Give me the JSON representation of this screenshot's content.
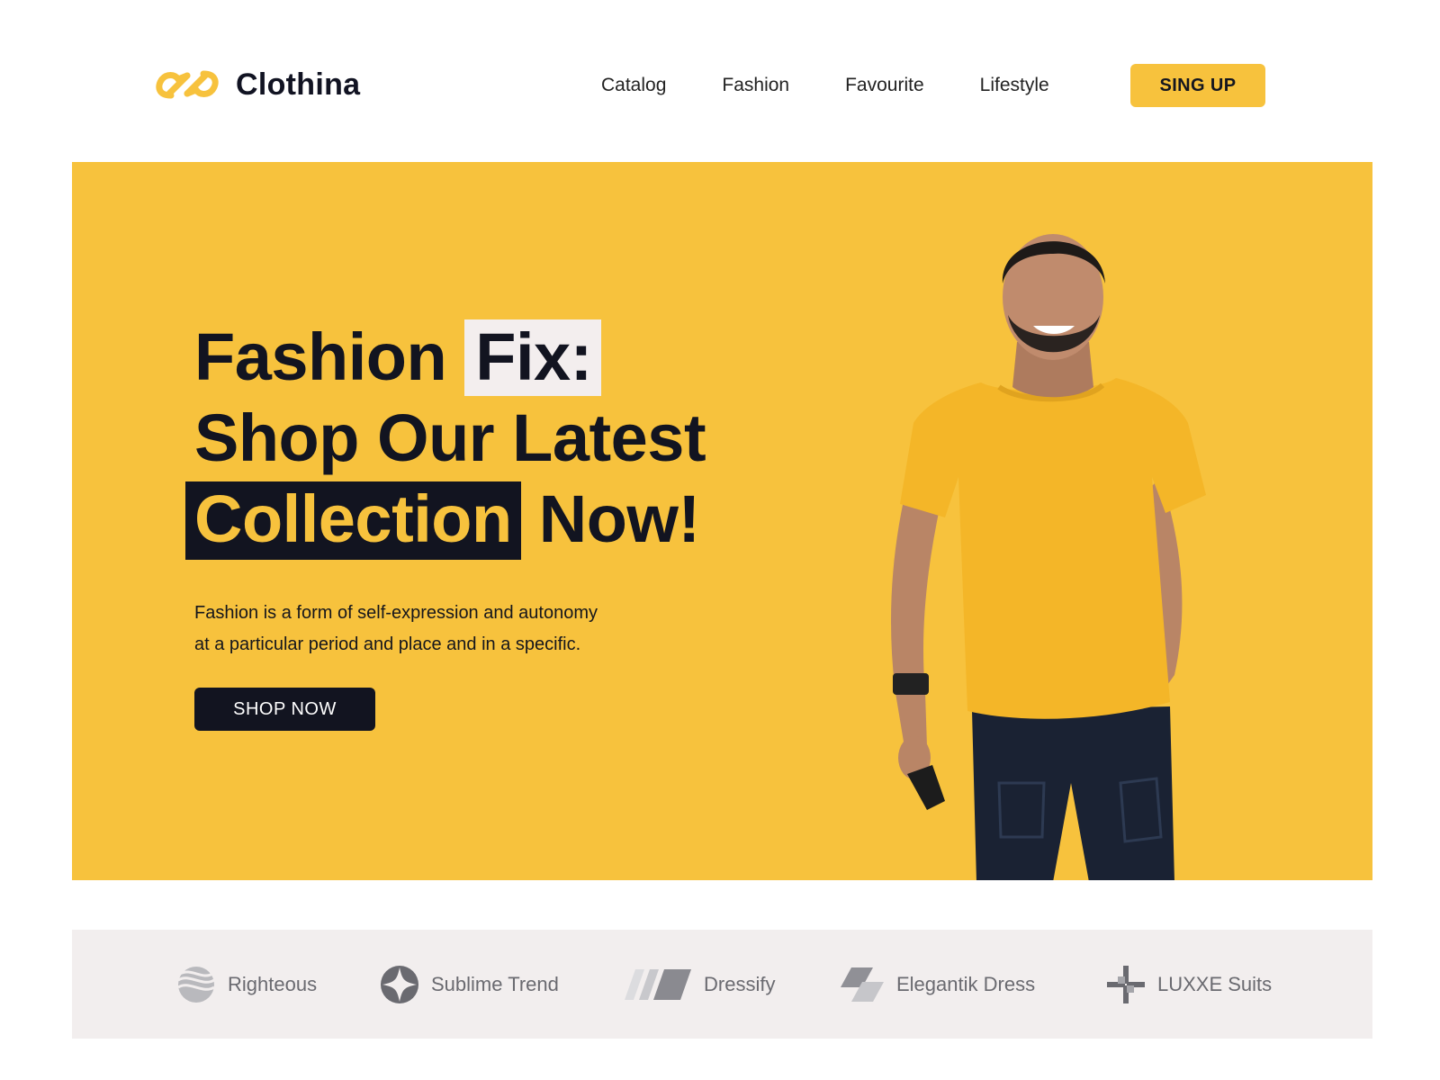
{
  "brand": {
    "name": "Clothina",
    "icon": "logo-infinity-icon",
    "color": "#f7c23d"
  },
  "nav": {
    "items": [
      "Catalog",
      "Fashion",
      "Favourite",
      "Lifestyle"
    ],
    "cta_label": "SING UP"
  },
  "hero": {
    "headline_word1": "Fashion",
    "headline_word2": "Fix:",
    "headline_line2": "Shop Our Latest",
    "headline_word3": "Collection",
    "headline_word4": "Now!",
    "subtext_line1": "Fashion is a form of self-expression and autonomy",
    "subtext_line2": "at a particular period and place and in a specific.",
    "cta_label": "SHOP NOW",
    "image": "smiling-man-yellow-tshirt",
    "background": "#f7c23d"
  },
  "brands": {
    "items": [
      {
        "name": "Righteous",
        "icon": "wave-sphere-icon"
      },
      {
        "name": "Sublime Trend",
        "icon": "star-circle-icon"
      },
      {
        "name": "Dressify",
        "icon": "slanted-bars-icon"
      },
      {
        "name": "Elegantik Dress",
        "icon": "stacked-parallelogram-icon"
      },
      {
        "name": "LUXXE Suits",
        "icon": "cross-pinwheel-icon"
      }
    ]
  }
}
